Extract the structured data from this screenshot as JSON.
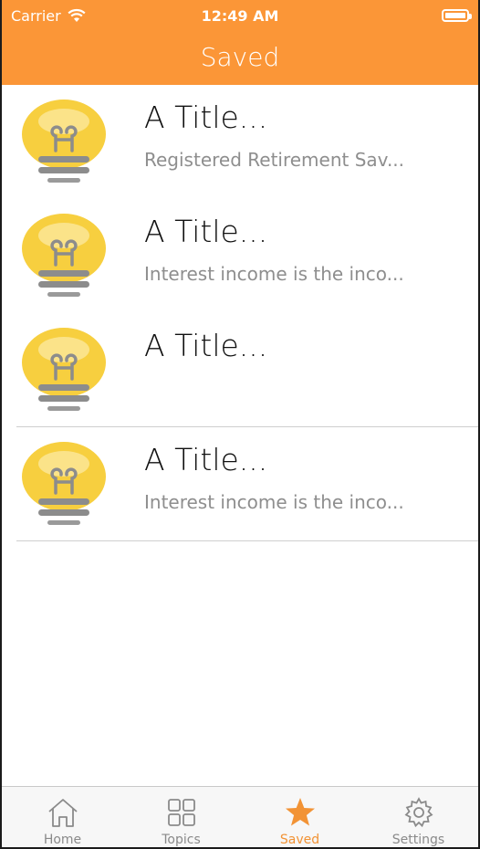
{
  "status_bar": {
    "carrier": "Carrier",
    "time": "12:49 AM"
  },
  "nav": {
    "title": "Saved"
  },
  "items": [
    {
      "title": "A Title...",
      "subtitle": "Registered Retirement Sav..."
    },
    {
      "title": "A Title...",
      "subtitle": "Interest income is the inco..."
    },
    {
      "title": "A Title...",
      "subtitle": ""
    },
    {
      "title": "A Title...",
      "subtitle": "Interest income is the inco..."
    }
  ],
  "tabs": [
    {
      "label": "Home",
      "icon": "home-icon"
    },
    {
      "label": "Topics",
      "icon": "grid-icon"
    },
    {
      "label": "Saved",
      "icon": "star-icon",
      "active": true
    },
    {
      "label": "Settings",
      "icon": "gear-icon"
    }
  ],
  "colors": {
    "accent": "#fb9637",
    "tab_active": "#f29335",
    "tab_inactive": "#8a8a8a"
  }
}
